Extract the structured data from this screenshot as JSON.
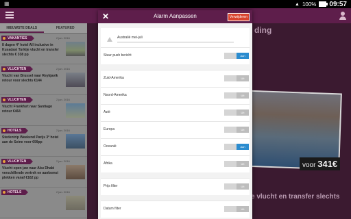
{
  "statusbar": {
    "battery": "100%",
    "time": "09:57"
  },
  "background": {
    "title_fragment": "ding",
    "price_prefix": "voor",
    "price_value": "341€",
    "bottom_fragment": "e vlucht en transfer slechts"
  },
  "left_panel": {
    "tabs": [
      "NIEUWSTE DEALS",
      "FEATURED"
    ],
    "deals": [
      {
        "category": "VAKANTIES",
        "date": "2 jan. 2016",
        "title": "8 dagen 4* hotel All inclusive in Kusadasi Turkije vlucht en transfer slechts € 338 pp"
      },
      {
        "category": "VLUCHTEN",
        "date": "2 jan. 2016",
        "title": "Vlucht van Brussel naar Reykjavík retour voor slechts €144"
      },
      {
        "category": "VLUCHTEN",
        "date": "2 jan. 2016",
        "title": "Vlucht Frankfurt naar Santiago retour €464"
      },
      {
        "category": "HOTELS",
        "date": "2 jan. 2016",
        "title": "Stedentrip Weekend Parijs 3* hotel aan de Seine voor €99pp"
      },
      {
        "category": "VLUCHTEN",
        "date": "2 jan. 2016",
        "title": "Vlucht open jaw naar Abu Dhabi verschillende vertrek en aankomst plekken vanaf €162 pp"
      },
      {
        "category": "HOTELS",
        "date": "2 jan. 2016",
        "title": ""
      }
    ]
  },
  "modal": {
    "title": "Alarm Aanpassen",
    "delete_label": "Verwijderen",
    "alarm_name": "Australië mei-juli",
    "push": {
      "label": "Stuur push bericht",
      "on_label": "Aan",
      "off_label": "Uit"
    },
    "regions": [
      {
        "label": "Zuid-Amerika",
        "state": "Uit"
      },
      {
        "label": "Noord-Amerika",
        "state": "Uit"
      },
      {
        "label": "Azië",
        "state": "Uit"
      },
      {
        "label": "Europa",
        "state": "Uit"
      },
      {
        "label": "Oceanië",
        "state": "Aan"
      },
      {
        "label": "Afrika",
        "state": "Uit"
      }
    ],
    "price_filter": {
      "label": "Prijs filter",
      "state": "Uit"
    },
    "date_filter": {
      "label": "Datum filter",
      "state": "Uit"
    }
  },
  "colors": {
    "brand_purple": "#5e1e4b",
    "toggle_on": "#2b8ccf",
    "delete_red": "#d9432d"
  }
}
